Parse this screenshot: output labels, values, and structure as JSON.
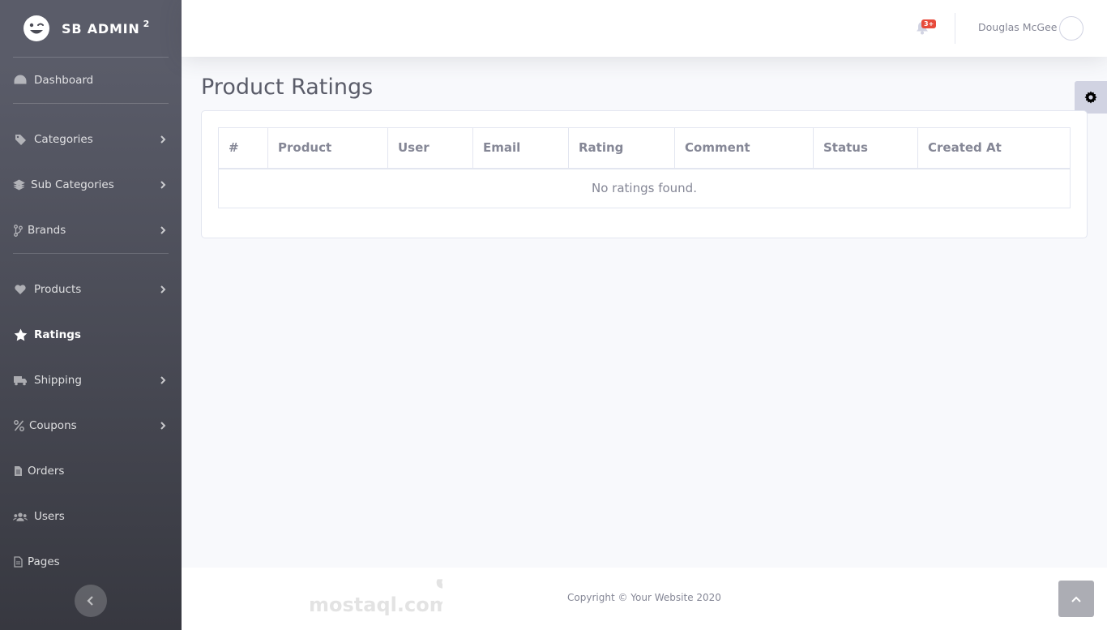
{
  "brand": {
    "name": "SB ADMIN",
    "sup": "2"
  },
  "sidebar": {
    "items": [
      {
        "label": "Dashboard",
        "icon": "tachometer-icon"
      },
      {
        "label": "Categories",
        "icon": "tag-icon"
      },
      {
        "label": "Sub Categories",
        "icon": "layer-icon"
      },
      {
        "label": "Brands",
        "icon": "code-branch-icon"
      },
      {
        "label": "Products",
        "icon": "heart-icon"
      },
      {
        "label": "Ratings",
        "icon": "star-icon"
      },
      {
        "label": "Shipping",
        "icon": "truck-icon"
      },
      {
        "label": "Coupons",
        "icon": "percent-icon"
      },
      {
        "label": "Orders",
        "icon": "file-invoice-icon"
      },
      {
        "label": "Users",
        "icon": "users-icon"
      },
      {
        "label": "Pages",
        "icon": "file-icon"
      }
    ],
    "active": "Ratings"
  },
  "topbar": {
    "badge": "3+",
    "user_name": "Douglas McGee"
  },
  "page": {
    "title": "Product Ratings"
  },
  "table": {
    "headers": [
      "#",
      "Product",
      "User",
      "Email",
      "Rating",
      "Comment",
      "Status",
      "Created At"
    ],
    "empty_message": "No ratings found."
  },
  "footer": {
    "copyright": "Copyright © Your Website 2020"
  },
  "watermark": {
    "arabic": "مستقل",
    "latin": "mostaql.com"
  },
  "colors": {
    "sidebar_top": "#5a5c69",
    "sidebar_bottom": "#373840",
    "badge": "#e74a3b",
    "background": "#f8f9fc"
  }
}
